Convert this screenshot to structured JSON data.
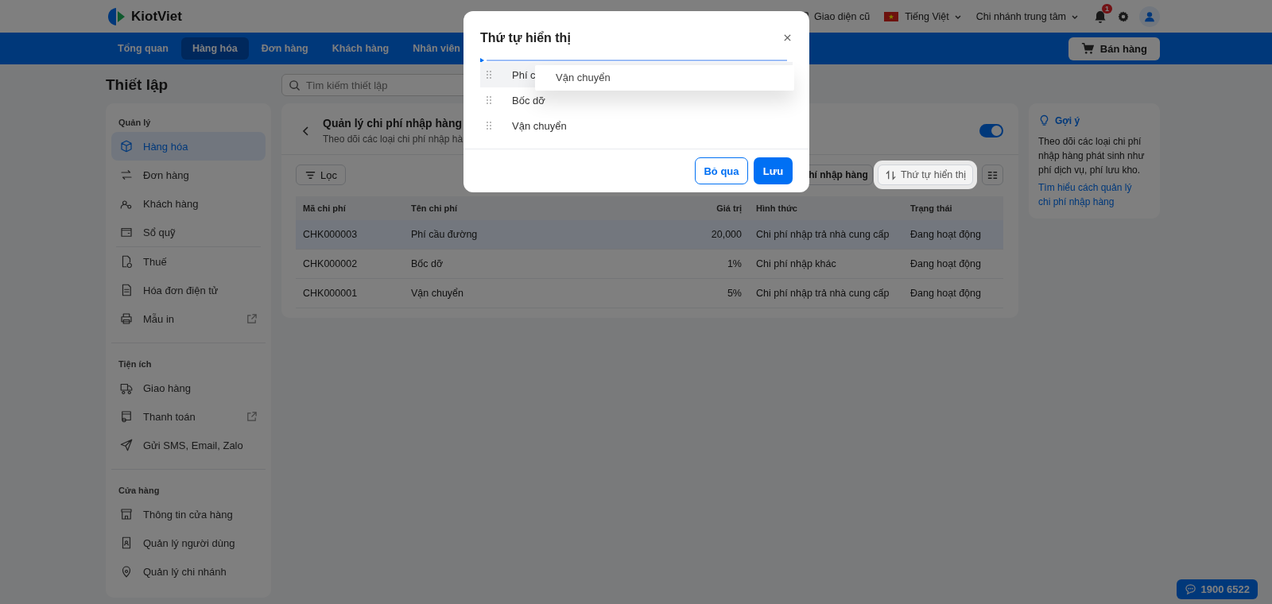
{
  "topbar": {
    "logo": "KiotViet",
    "old_ui": "Giao diện cũ",
    "language": "Tiếng Việt",
    "branch": "Chi nhánh trung tâm",
    "notifications": "1"
  },
  "nav": {
    "tabs": [
      {
        "label": "Tổng quan",
        "selected": false
      },
      {
        "label": "Hàng hóa",
        "selected": true
      },
      {
        "label": "Đơn hàng",
        "selected": false
      },
      {
        "label": "Khách hàng",
        "selected": false
      },
      {
        "label": "Nhân viên",
        "selected": false
      }
    ],
    "sell_button": "Bán hàng"
  },
  "page_title": "Thiết lập",
  "search": {
    "placeholder": "Tìm kiếm thiết lập"
  },
  "sidebar": {
    "sections": [
      {
        "title": "Quản lý",
        "groups": [
          [
            {
              "label": "Hàng hóa",
              "selected": true,
              "external": false
            },
            {
              "label": "Đơn hàng",
              "selected": false,
              "external": false
            },
            {
              "label": "Khách hàng",
              "selected": false,
              "external": false
            },
            {
              "label": "Sổ quỹ",
              "selected": false,
              "external": false
            }
          ],
          [
            {
              "label": "Thuế",
              "selected": false,
              "external": false
            },
            {
              "label": "Hóa đơn điện tử",
              "selected": false,
              "external": false
            },
            {
              "label": "Mẫu in",
              "selected": false,
              "external": true
            }
          ]
        ]
      },
      {
        "title": "Tiện ích",
        "groups": [
          [
            {
              "label": "Giao hàng",
              "selected": false,
              "external": false
            },
            {
              "label": "Thanh toán",
              "selected": false,
              "external": true
            },
            {
              "label": "Gửi SMS, Email, Zalo",
              "selected": false,
              "external": false
            }
          ]
        ]
      },
      {
        "title": "Cửa hàng",
        "groups": [
          [
            {
              "label": "Thông tin cửa hàng",
              "selected": false,
              "external": false
            },
            {
              "label": "Quản lý người dùng",
              "selected": false,
              "external": false
            },
            {
              "label": "Quản lý chi nhánh",
              "selected": false,
              "external": false
            }
          ]
        ]
      }
    ]
  },
  "card": {
    "title": "Quản lý chi phí nhập hàng",
    "subtitle": "Theo dõi các loại chi phí nhập hà",
    "enabled": true,
    "filter_button": "Lọc",
    "add_button": "hí nhập hàng",
    "order_button": "Thứ tự hiển thị"
  },
  "table": {
    "columns": [
      "Mã chi phí",
      "Tên chi phí",
      "Giá trị",
      "Hình thức",
      "Trạng thái"
    ],
    "rows": [
      {
        "cells": [
          "CHK000003",
          "Phí cầu đường",
          "20,000",
          "Chi phí nhập trả nhà cung cấp",
          "Đang hoạt động"
        ],
        "selected": true
      },
      {
        "cells": [
          "CHK000002",
          "Bốc dỡ",
          "1%",
          "Chi phí nhập khác",
          "Đang hoạt động"
        ],
        "selected": false
      },
      {
        "cells": [
          "CHK000001",
          "Vận chuyển",
          "5%",
          "Chi phí nhập trả nhà cung cấp",
          "Đang hoạt động"
        ],
        "selected": false
      }
    ]
  },
  "hint": {
    "title": "Gợi ý",
    "text": "Theo dõi các loại chi phí nhập hàng phát sinh như phí dịch vụ, phí lưu kho.",
    "link": "Tìm hiểu cách quản lý chi phí nhập hàng"
  },
  "hotline": "1900 6522",
  "modal": {
    "title": "Thứ tự hiển thị",
    "items": [
      {
        "label": "Phí c",
        "selected": true
      },
      {
        "label": "Bốc dỡ",
        "selected": false
      },
      {
        "label": "Vận chuyển",
        "selected": false
      }
    ],
    "drag_ghost": "Vận chuyển",
    "cancel_button": "Bỏ qua",
    "save_button": "Lưu"
  }
}
